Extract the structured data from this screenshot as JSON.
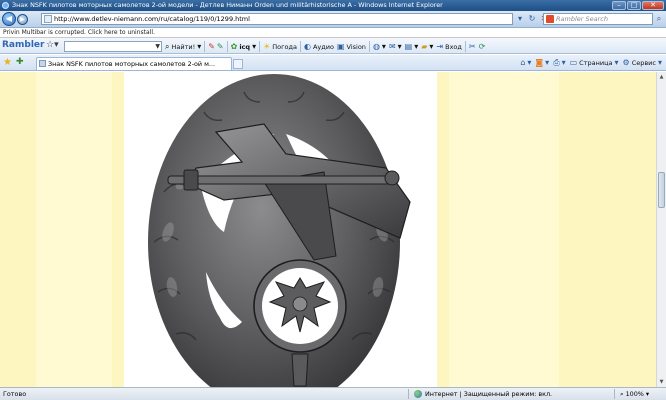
{
  "window": {
    "title": "Знак NSFK пилотов моторных самолетов 2-ой модели - Детлев Ниманн Orden und militärhistorische A - Windows Internet Explorer"
  },
  "address_bar": {
    "url": "http://www.detlev-niemann.com/ru/catalog/119/0/1299.html",
    "search_placeholder": "Rambler Search"
  },
  "info_bar": {
    "message": "Privin Multibar is corrupted. Click here to uninstall."
  },
  "rambler_toolbar": {
    "logo": "Rambler",
    "find_label": "Найти!",
    "icq_label": "icq",
    "weather_label": "Погода",
    "audio_label": "Аудио",
    "vision_label": "Vision",
    "login_label": "Вход"
  },
  "tabs": [
    {
      "label": "Знак NSFK пилотов моторных самолетов 2-ой м..."
    }
  ],
  "command_bar": {
    "page_label": "Страница",
    "tools_label": "Сервис"
  },
  "status_bar": {
    "status": "Готово",
    "zone": "Интернет | Защищенный режим: вкл.",
    "zoom": "100%"
  },
  "colors": {
    "page_background": "#fdf6c0",
    "page_band": "#fffad2",
    "badge_metal": "#5a5a5c"
  }
}
